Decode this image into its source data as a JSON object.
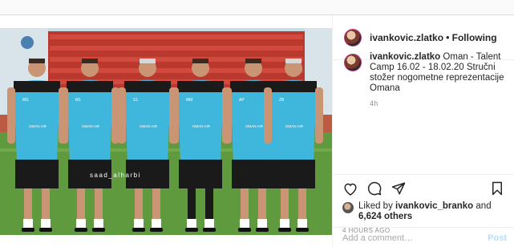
{
  "header": {
    "username": "ivankovic.zlatko",
    "separator": "•",
    "follow_status": "Following"
  },
  "photo": {
    "watermark": "saad_alharbi",
    "shirt_sponsor": "OMAN AIR",
    "player_badges": [
      "MS",
      "M1",
      "S1",
      "MM",
      "AP",
      "ZB"
    ]
  },
  "caption": {
    "username": "ivankovic.zlatko",
    "text": "Oman - Talent Camp 16.02 - 18.02.20 Stručni stožer nogometne reprezentacije Omana",
    "age": "4h"
  },
  "actions": {
    "icons": [
      "heart-icon",
      "comment-icon",
      "share-icon",
      "bookmark-icon"
    ]
  },
  "likes": {
    "prefix": "Liked by",
    "user": "ivankovic_branko",
    "connector": "and",
    "others": "6,624 others"
  },
  "posted_ago": "4 HOURS AGO",
  "comment_box": {
    "placeholder": "Add a comment…",
    "post_label": "Post"
  },
  "colors": {
    "shirt_cyan": "#3fb6dc",
    "shirt_black": "#1a1a1a",
    "post_button": "#b2dffc",
    "muted_text": "#8e8e8e"
  }
}
